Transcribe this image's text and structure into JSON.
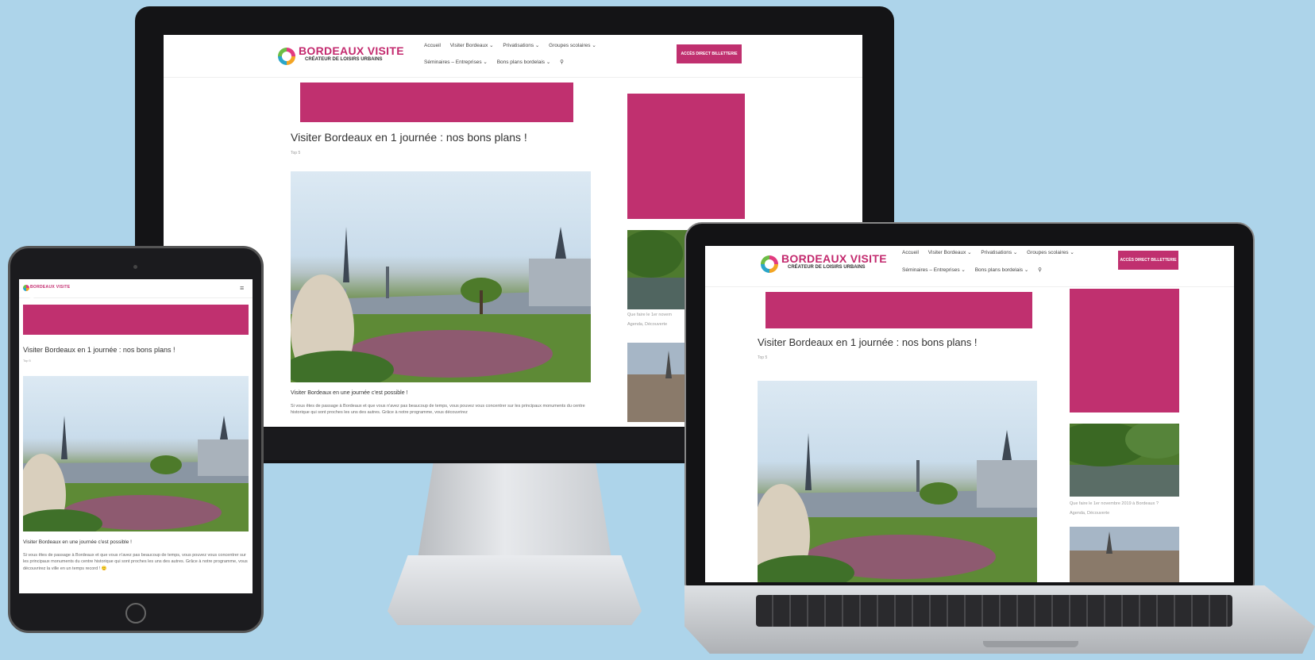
{
  "site": {
    "brand": "BORDEAUX VISITE",
    "tagline": "CRÉATEUR DE LOISIRS URBAINS",
    "nav_row1": [
      "Accueil",
      "Visiter Bordeaux ⌄",
      "Privatisations ⌄",
      "Groupes scolaires ⌄"
    ],
    "nav_row2": [
      "Séminaires – Entreprises ⌄",
      "Bons plans bordelais ⌄"
    ],
    "search_icon": "search-icon",
    "cta": "ACCÈS DIRECT BILLETTERIE",
    "menu_icon": "≡",
    "accent_color": "#c0306f"
  },
  "article": {
    "title": "Visiter Bordeaux en 1 journée : nos bons plans !",
    "meta": "Top 5",
    "subheading": "Visiter Bordeaux en une journée c'est possible !",
    "body_monitor": "Si vous êtes de passage à Bordeaux et que vous n'avez pas beaucoup de temps, vous pouvez vous concentrer sur les principaux monuments du centre historique qui sont proches les uns des autres. Grâce à notre programme, vous découvrirez",
    "body_tablet": "Si vous êtes de passage à Bordeaux et que vous n'avez pas beaucoup de temps, vous pouvez vous concentrer sur les principaux monuments du centre historique qui sont proches les uns des autres. Grâce à notre programme, vous découvrirez la ville en un temps record ! 🙂"
  },
  "sidebar": {
    "caption_1": "Que faire le 1er novembre 2019 à Bordeaux ?",
    "caption_1_short": "Que faire le 1er novem",
    "category_1": "Agenda, Découverte"
  }
}
